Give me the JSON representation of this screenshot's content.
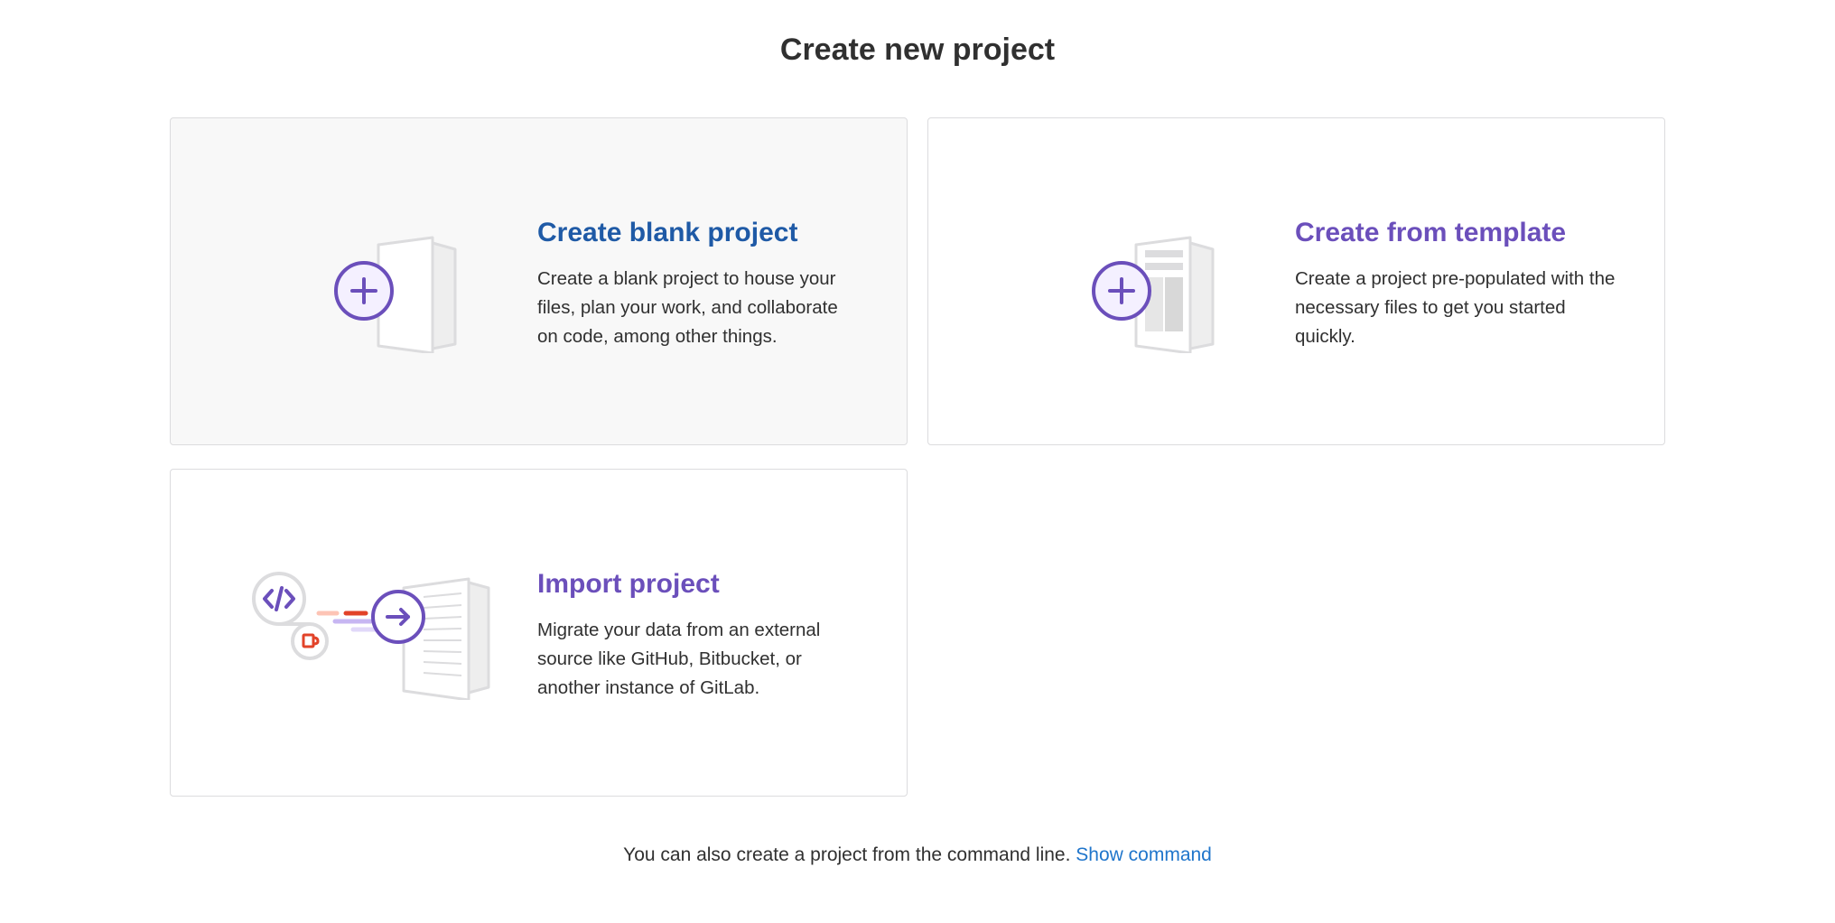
{
  "page": {
    "title": "Create new project"
  },
  "cards": [
    {
      "title": "Create blank project",
      "description": "Create a blank project to house your files, plan your work, and collaborate on code, among other things.",
      "state": "hovered",
      "icon": "blank-project-illustration"
    },
    {
      "title": "Create from template",
      "description": "Create a project pre-populated with the necessary files to get you started quickly.",
      "icon": "template-project-illustration"
    },
    {
      "title": "Import project",
      "description": "Migrate your data from an external source like GitHub, Bitbucket, or another instance of GitLab.",
      "icon": "import-project-illustration"
    }
  ],
  "footer": {
    "note": "You can also create a project from the command line.",
    "link_label": "Show command"
  },
  "colors": {
    "purple": "#6b4fbb",
    "blue_title": "#1f5aa6",
    "link": "#1f75cb",
    "orange": "#e24329",
    "text": "#303030",
    "border": "#dcdcde"
  }
}
